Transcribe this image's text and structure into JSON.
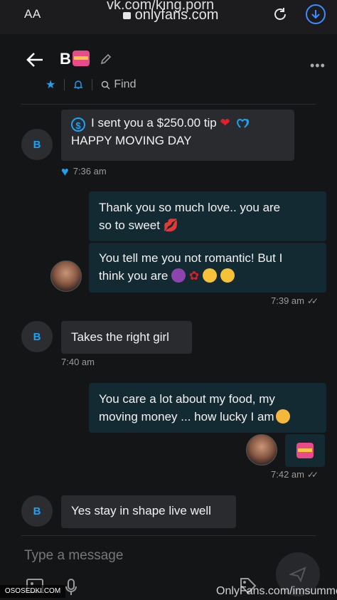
{
  "browser": {
    "text_size_label": "AA",
    "url": "onlyfans.com",
    "watermark_top": "vk.com/king.porn"
  },
  "chat_header": {
    "contact_name": "B",
    "find_label": "Find"
  },
  "messages": [
    {
      "avatar_letter": "B",
      "tip_text": "I sent you a $250.00 tip",
      "text": "HAPPY MOVING DAY",
      "time": "7:36 am"
    },
    {
      "text_line1": "Thank you so much love.. you are",
      "text_line2": "so to sweet"
    },
    {
      "text_line1": "You tell me you not romantic! But I",
      "text_line2": "think you are",
      "time": "7:39 am"
    },
    {
      "avatar_letter": "B",
      "text": "Takes the right girl",
      "time": "7:40 am"
    },
    {
      "text_line1": "You care a lot about my food, my",
      "text_line2": "moving money ... how lucky I am",
      "time": "7:42 am"
    },
    {
      "avatar_letter": "B",
      "text": "Yes stay in shape live well"
    }
  ],
  "composer": {
    "placeholder": "Type a message"
  },
  "watermarks": {
    "bottom_right": "OnlyFans.com/imsummer",
    "bottom_left": "OSOSEDKI.COM"
  },
  "colors": {
    "accent": "#1da1f2",
    "background": "#141517",
    "incoming_bubble": "#2a2b2e",
    "outgoing_bubble": "#142a33"
  }
}
